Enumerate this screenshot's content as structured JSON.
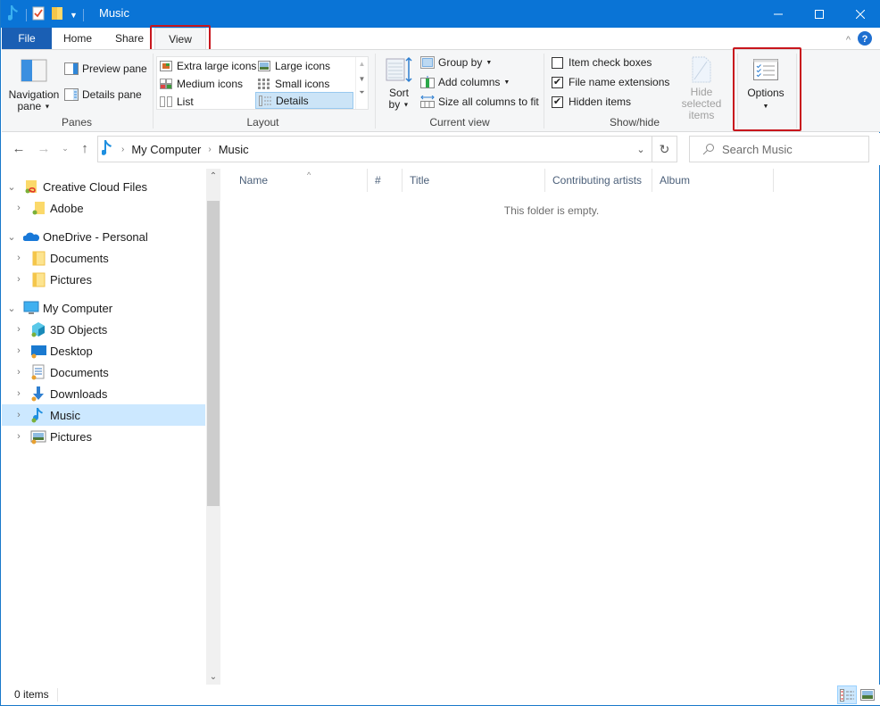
{
  "window": {
    "title": "Music",
    "controls": {
      "minimize": "minimize-icon",
      "maximize": "maximize-icon",
      "close": "close-icon"
    }
  },
  "quick_access": [
    "music-note-icon",
    "properties-icon",
    "new-folder-icon",
    "customize-qat-icon"
  ],
  "ribbon": {
    "tabs": [
      {
        "label": "File",
        "active": false
      },
      {
        "label": "Home",
        "active": false
      },
      {
        "label": "Share",
        "active": false
      },
      {
        "label": "View",
        "active": true,
        "highlighted": true
      }
    ],
    "groups": {
      "panes": {
        "label": "Panes",
        "navigation_pane": {
          "line1": "Navigation",
          "line2": "pane"
        },
        "preview_pane": "Preview pane",
        "details_pane": "Details pane"
      },
      "layout": {
        "label": "Layout",
        "items": [
          {
            "label": "Extra large icons",
            "selected": false
          },
          {
            "label": "Large icons",
            "selected": false
          },
          {
            "label": "Medium icons",
            "selected": false
          },
          {
            "label": "Small icons",
            "selected": false
          },
          {
            "label": "List",
            "selected": false
          },
          {
            "label": "Details",
            "selected": true
          }
        ]
      },
      "current_view": {
        "label": "Current view",
        "sort_by": {
          "line1": "Sort",
          "line2": "by"
        },
        "group_by": "Group by",
        "add_columns": "Add columns",
        "size_columns": "Size all columns to fit"
      },
      "show_hide": {
        "label": "Show/hide",
        "item_check_boxes": {
          "label": "Item check boxes",
          "checked": false
        },
        "file_name_extensions": {
          "label": "File name extensions",
          "checked": true
        },
        "hidden_items": {
          "label": "Hidden items",
          "checked": true
        },
        "hide_selected": {
          "line1": "Hide selected",
          "line2": "items",
          "enabled": false
        }
      },
      "options": {
        "label": "Options",
        "highlighted": true
      }
    }
  },
  "address": {
    "breadcrumb": [
      "My Computer",
      "Music"
    ],
    "search_placeholder": "Search Music"
  },
  "nav_tree": [
    {
      "label": "Creative Cloud Files",
      "level": 0,
      "expanded": true,
      "icon": "creative-cloud-folder-icon"
    },
    {
      "label": "Adobe",
      "level": 1,
      "expanded": false,
      "icon": "folder-synced-icon"
    },
    {
      "label": "OneDrive - Personal",
      "level": 0,
      "expanded": true,
      "icon": "onedrive-cloud-icon"
    },
    {
      "label": "Documents",
      "level": 1,
      "expanded": false,
      "icon": "folder-icon"
    },
    {
      "label": "Pictures",
      "level": 1,
      "expanded": false,
      "icon": "folder-icon"
    },
    {
      "label": "My Computer",
      "level": 0,
      "expanded": true,
      "icon": "computer-icon"
    },
    {
      "label": "3D Objects",
      "level": 1,
      "expanded": false,
      "icon": "3d-objects-icon"
    },
    {
      "label": "Desktop",
      "level": 1,
      "expanded": false,
      "icon": "desktop-icon"
    },
    {
      "label": "Documents",
      "level": 1,
      "expanded": false,
      "icon": "documents-icon"
    },
    {
      "label": "Downloads",
      "level": 1,
      "expanded": false,
      "icon": "downloads-icon"
    },
    {
      "label": "Music",
      "level": 1,
      "expanded": false,
      "icon": "music-icon",
      "selected": true
    },
    {
      "label": "Pictures",
      "level": 1,
      "expanded": false,
      "icon": "pictures-icon"
    }
  ],
  "content": {
    "columns": [
      "Name",
      "#",
      "Title",
      "Contributing artists",
      "Album"
    ],
    "sorted_column": "Name",
    "empty_message": "This folder is empty."
  },
  "status": {
    "item_count": "0 items",
    "view_mode": "details"
  },
  "colors": {
    "titlebar": "#0a74d6",
    "file_tab": "#1a5fb4",
    "highlight_box": "#c8161d",
    "selection": "#cce8ff"
  }
}
